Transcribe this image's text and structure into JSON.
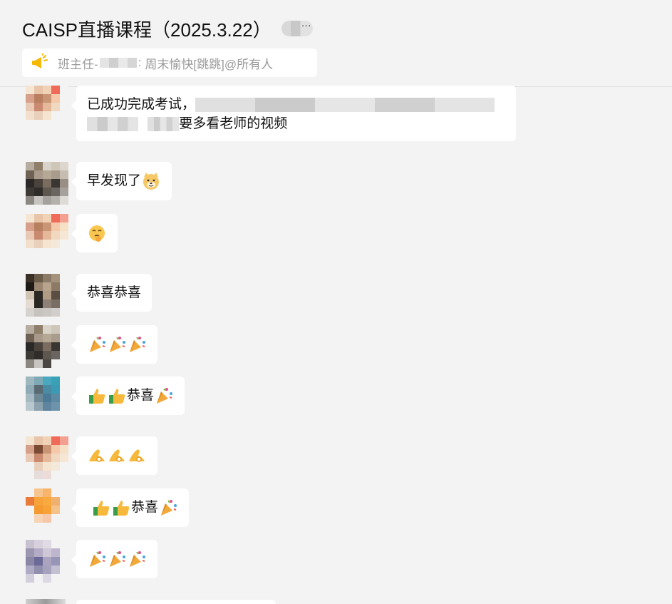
{
  "header": {
    "title": "CAISP直播课程（2025.3.22）",
    "more_glyph": "···"
  },
  "announcement": {
    "icon": "megaphone-icon",
    "sender_prefix": "班主任-",
    "sender_suffix": ":",
    "text": "周末愉快[跳跳]@所有人"
  },
  "messages": [
    {
      "text_a": "已成功完成考试，",
      "text_b": "要多看老师的视频"
    },
    {
      "text": "早发现了"
    },
    {
      "text": ""
    },
    {
      "text": "恭喜恭喜"
    },
    {
      "text": ""
    },
    {
      "text": "恭喜"
    },
    {
      "text": ""
    },
    {
      "text": "恭喜"
    },
    {
      "text": ""
    }
  ]
}
